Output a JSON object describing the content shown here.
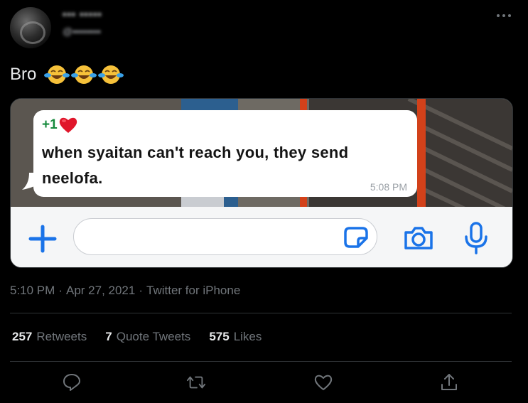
{
  "tweet": {
    "author_name": "▪▪▪ ▪▪▪▪▪",
    "author_handle": "@▪▪▪▪▪▪▪▪",
    "text": "Bro",
    "emojis": [
      "face-with-tears-of-joy",
      "face-with-tears-of-joy",
      "face-with-tears-of-joy"
    ],
    "time": "5:10 PM",
    "date": "Apr 27, 2021",
    "source": "Twitter for iPhone",
    "separator": "·"
  },
  "media": {
    "reply_prefix": "+1",
    "message_text": "when syaitan can't reach you, they send neelofa.",
    "message_time": "5:08 PM",
    "heart_icon": "red-heart-icon",
    "accent_color": "#1a73e8"
  },
  "stats": {
    "retweets_count": "257",
    "retweets_label": "Retweets",
    "quote_count": "7",
    "quote_label": "Quote Tweets",
    "likes_count": "575",
    "likes_label": "Likes"
  },
  "actions": [
    "reply-icon",
    "retweet-icon",
    "like-icon",
    "share-icon"
  ],
  "colors": {
    "background": "#000000",
    "text_primary": "#e7e9ea",
    "text_secondary": "#71767b",
    "divider": "#2f3336",
    "whatsapp_green": "#168a3c"
  }
}
